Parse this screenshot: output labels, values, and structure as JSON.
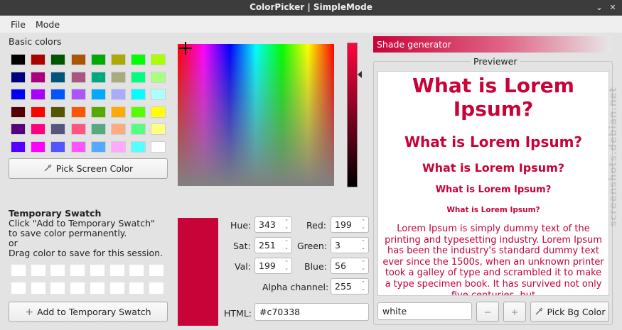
{
  "window": {
    "title": "ColorPicker | SimpleMode",
    "min_icon": "minimize-icon",
    "close_icon": "close-icon"
  },
  "menu": {
    "file": "File",
    "mode": "Mode"
  },
  "basic": {
    "label": "Basic colors",
    "colors": [
      "#000000",
      "#aa0000",
      "#005500",
      "#aa5500",
      "#00aa00",
      "#aaaa00",
      "#00ff00",
      "#aaff00",
      "#00007f",
      "#aa007f",
      "#00557f",
      "#aa557f",
      "#00aa7f",
      "#aaaa7f",
      "#00ff7f",
      "#aaff7f",
      "#0000ff",
      "#aa00ff",
      "#0055ff",
      "#aa55ff",
      "#00aaff",
      "#aaaaff",
      "#00ffff",
      "#aaffff",
      "#550000",
      "#ff0000",
      "#555500",
      "#ff5500",
      "#55aa00",
      "#ffaa00",
      "#55ff00",
      "#ffff00",
      "#55007f",
      "#ff007f",
      "#55557f",
      "#ff557f",
      "#55aa7f",
      "#ffaa7f",
      "#55ff7f",
      "#ffff7f",
      "#5500ff",
      "#ff00ff",
      "#5555ff",
      "#ff55ff",
      "#55aaff",
      "#ffaaff",
      "#55ffff",
      "#ffffff"
    ],
    "pick_screen": "Pick Screen Color"
  },
  "temp": {
    "title": "Temporary Swatch",
    "line1": "Click \"Add to Temporary Swatch\"",
    "line2": "to save color permanently.",
    "line3": "or",
    "line4": "Drag color to save for this session.",
    "add_button": "Add to Temporary Swatch"
  },
  "values": {
    "hue_label": "Hue:",
    "hue": "343",
    "sat_label": "Sat:",
    "sat": "251",
    "val_label": "Val:",
    "val": "199",
    "red_label": "Red:",
    "red": "199",
    "green_label": "Green:",
    "green": "3",
    "blue_label": "Blue:",
    "blue": "56",
    "alpha_label": "Alpha channel:",
    "alpha": "255",
    "html_label": "HTML:",
    "html": "#c70338"
  },
  "colors": {
    "current": "#c70338"
  },
  "shade": {
    "title": "Shade generator"
  },
  "previewer": {
    "title": "Previewer",
    "h1": "What is Lorem Ipsum?",
    "h2": "What is Lorem Ipsum?",
    "h3": "What is Lorem Ipsum?",
    "h4": "What is Lorem Ipsum?",
    "h5": "What is Lorem Ipsum?",
    "body": "Lorem Ipsum is simply dummy text of the printing and typesetting industry. Lorem Ipsum has been the industry's standard dummy text ever since the 1500s, when an unknown printer took a galley of type and scrambled it to make a type specimen book. It has survived not only five centuries, but",
    "bg_value": "white",
    "minus": "−",
    "plus": "+",
    "pick_bg": "Pick Bg Color"
  },
  "watermark": "screenshots.debian.net"
}
